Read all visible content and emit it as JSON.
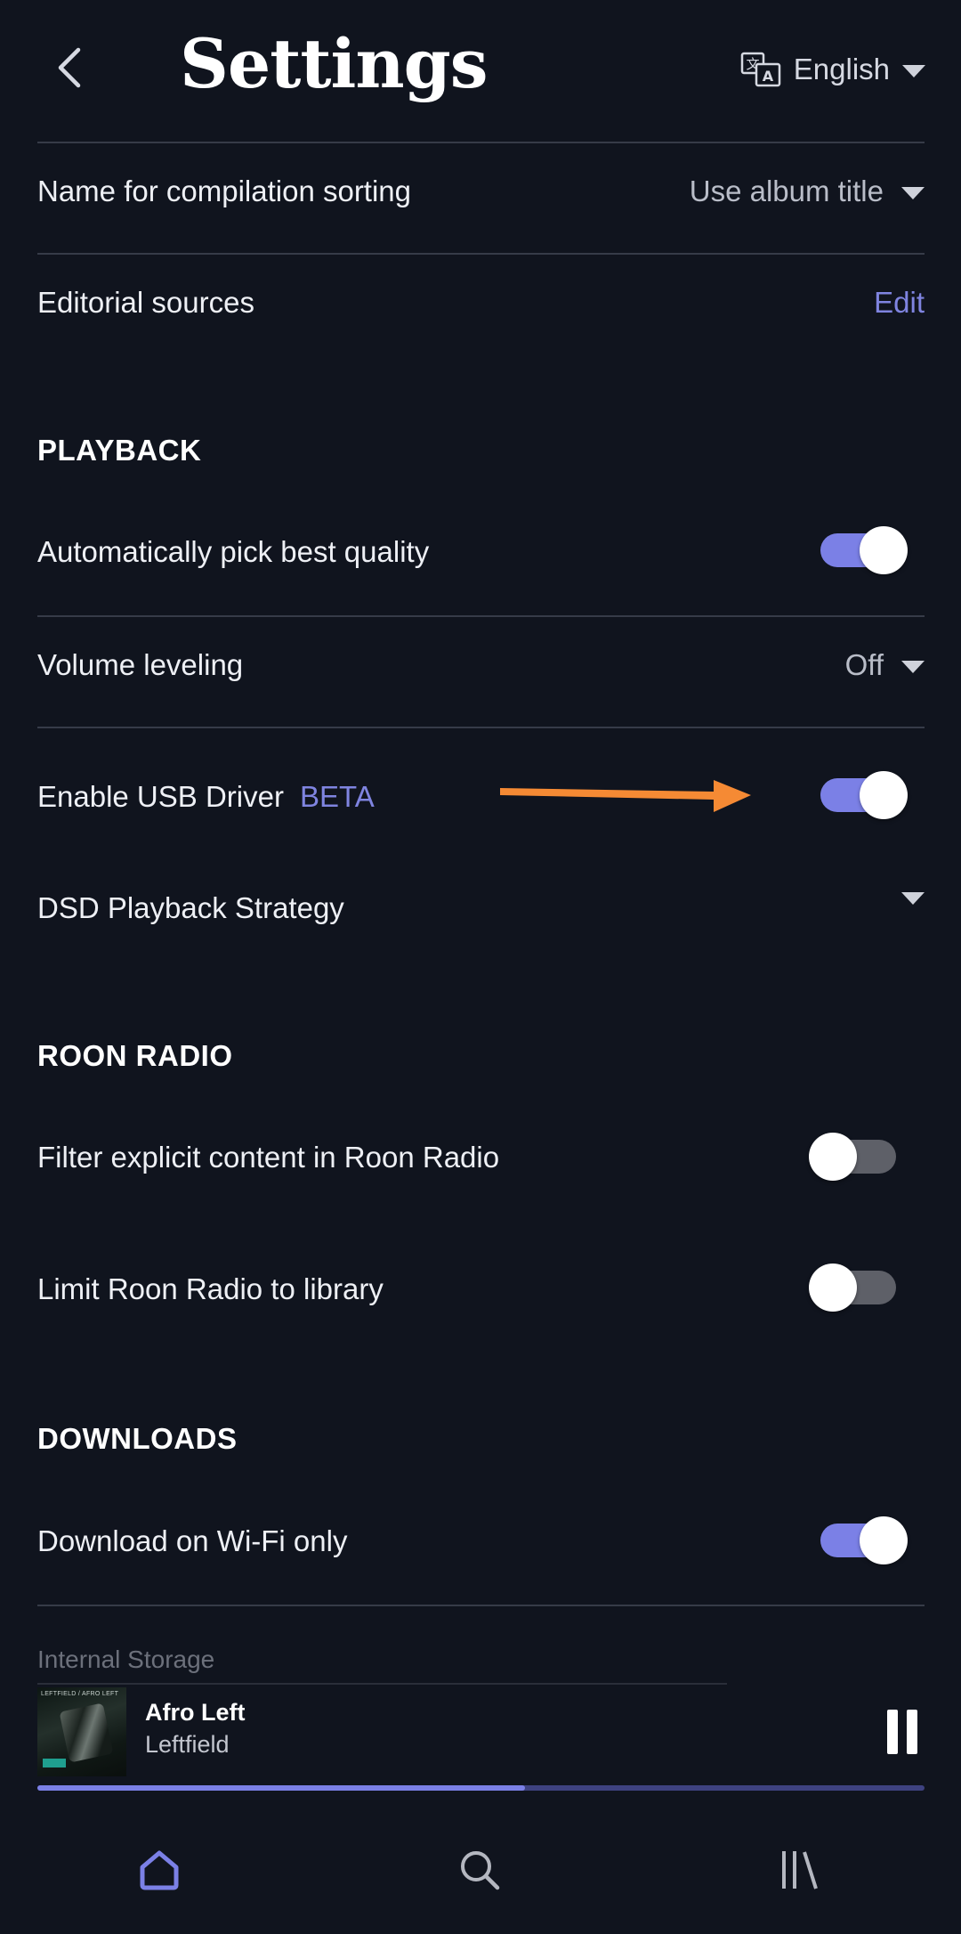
{
  "header": {
    "title": "Settings",
    "language": "English"
  },
  "rows": {
    "compilation_sorting": {
      "label": "Name for compilation sorting",
      "value": "Use album title"
    },
    "editorial_sources": {
      "label": "Editorial sources",
      "action": "Edit"
    }
  },
  "playback": {
    "header": "PLAYBACK",
    "auto_quality": {
      "label": "Automatically pick best quality",
      "enabled": true
    },
    "volume_leveling": {
      "label": "Volume leveling",
      "value": "Off"
    },
    "usb_driver": {
      "label": "Enable USB Driver",
      "tag": "BETA",
      "enabled": true
    },
    "dsd_strategy": {
      "label": "DSD Playback Strategy",
      "value": ""
    }
  },
  "roon_radio": {
    "header": "ROON RADIO",
    "filter_explicit": {
      "label": "Filter explicit content in Roon Radio",
      "enabled": false
    },
    "limit_library": {
      "label": "Limit Roon Radio to library",
      "enabled": false
    }
  },
  "downloads": {
    "header": "DOWNLOADS",
    "wifi_only": {
      "label": "Download on Wi-Fi only",
      "enabled": true
    },
    "storage_label": "Internal Storage"
  },
  "player": {
    "track_title": "Afro Left",
    "artist": "Leftfield",
    "progress": 0.55,
    "art_text": "LEFTFIELD / AFRO LEFT"
  },
  "nav": {
    "items": [
      "home-icon",
      "search-icon",
      "library-icon"
    ]
  },
  "colors": {
    "background": "#10141e",
    "accent": "#7b80e6",
    "annotation_arrow": "#f58a34"
  }
}
